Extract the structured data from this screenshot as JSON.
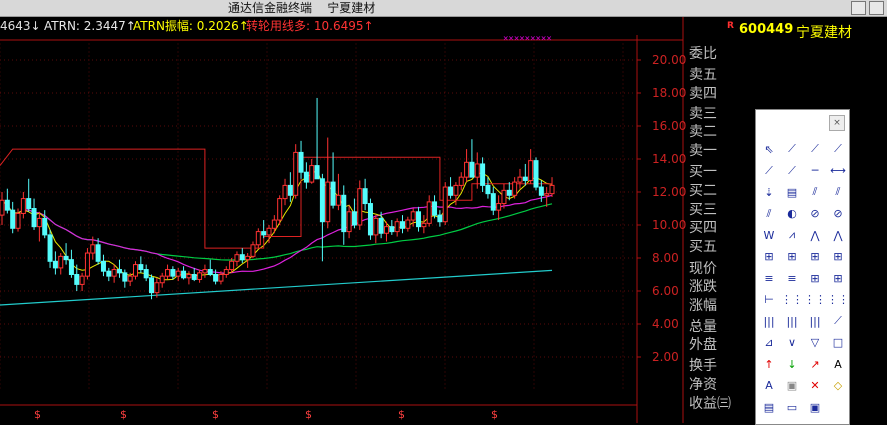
{
  "window": {
    "title": "通达信金融终端    宁夏建材"
  },
  "indicators": [
    {
      "text": "4643↓",
      "color": "#e0e0e0"
    },
    {
      "text": "ATRN: 2.3447↑",
      "color": "#e8e8e8"
    },
    {
      "text": "ATRN振幅: 0.2026↑",
      "color": "#ffff00"
    },
    {
      "text": "转轮用线多: 10.6495↑",
      "color": "#ff3333"
    }
  ],
  "stock": {
    "marker": "R",
    "code": "600449",
    "name": "宁夏建材"
  },
  "y_axis": {
    "ticks": [
      "20.00",
      "18.00",
      "16.00",
      "14.00",
      "12.00",
      "10.00",
      "8.00",
      "6.00",
      "4.00",
      "2.00"
    ]
  },
  "quote_labels": [
    "委比",
    "卖五",
    "卖四",
    "卖三",
    "卖二",
    "卖一",
    "买一",
    "买二",
    "买三",
    "买四",
    "买五",
    "现价",
    "涨跌",
    "涨幅",
    "总量",
    "外盘",
    "换手",
    "净资",
    "收益㈢"
  ],
  "signal_marker": "$",
  "chart_data": {
    "type": "candlestick",
    "title": "",
    "ylim": [
      0,
      21
    ],
    "ohlc": [
      [
        10.6,
        12.0,
        10.0,
        11.5
      ],
      [
        11.5,
        12.2,
        10.7,
        10.9
      ],
      [
        10.9,
        11.4,
        9.5,
        9.8
      ],
      [
        9.8,
        11.0,
        9.6,
        10.7
      ],
      [
        10.7,
        12.0,
        10.4,
        11.6
      ],
      [
        11.6,
        12.8,
        10.8,
        11.0
      ],
      [
        11.0,
        11.6,
        9.7,
        9.9
      ],
      [
        9.9,
        10.8,
        9.0,
        10.4
      ],
      [
        10.4,
        10.9,
        9.2,
        9.4
      ],
      [
        9.4,
        9.7,
        7.4,
        7.8
      ],
      [
        7.8,
        8.4,
        7.0,
        7.4
      ],
      [
        7.4,
        8.3,
        7.0,
        8.1
      ],
      [
        8.1,
        8.9,
        7.6,
        7.9
      ],
      [
        7.9,
        8.5,
        6.8,
        7.0
      ],
      [
        7.0,
        7.6,
        6.0,
        6.4
      ],
      [
        6.4,
        7.1,
        6.0,
        6.9
      ],
      [
        6.9,
        8.6,
        6.7,
        8.3
      ],
      [
        8.3,
        9.3,
        7.9,
        8.8
      ],
      [
        8.8,
        9.2,
        7.6,
        7.8
      ],
      [
        7.8,
        8.2,
        6.9,
        7.2
      ],
      [
        7.2,
        7.4,
        6.6,
        6.9
      ],
      [
        6.9,
        7.6,
        6.5,
        7.3
      ],
      [
        7.3,
        7.9,
        6.8,
        7.1
      ],
      [
        7.1,
        7.3,
        6.2,
        6.6
      ],
      [
        6.6,
        7.1,
        6.3,
        6.9
      ],
      [
        6.9,
        7.8,
        6.7,
        7.6
      ],
      [
        7.6,
        8.1,
        7.1,
        7.3
      ],
      [
        7.3,
        7.6,
        6.6,
        6.8
      ],
      [
        6.8,
        7.0,
        5.5,
        5.9
      ],
      [
        5.9,
        6.8,
        5.6,
        6.5
      ],
      [
        6.5,
        7.1,
        6.2,
        6.9
      ],
      [
        6.9,
        7.6,
        6.7,
        7.3
      ],
      [
        7.3,
        7.5,
        6.7,
        6.9
      ],
      [
        6.9,
        7.4,
        6.6,
        7.2
      ],
      [
        7.2,
        7.5,
        6.7,
        6.8
      ],
      [
        6.8,
        7.2,
        6.4,
        7.0
      ],
      [
        7.0,
        7.4,
        6.6,
        6.7
      ],
      [
        6.7,
        7.3,
        6.5,
        7.1
      ],
      [
        7.1,
        7.6,
        6.8,
        7.3
      ],
      [
        7.3,
        7.9,
        6.9,
        7.0
      ],
      [
        7.0,
        7.3,
        6.4,
        6.6
      ],
      [
        6.6,
        7.2,
        6.4,
        7.0
      ],
      [
        7.0,
        7.5,
        6.8,
        7.3
      ],
      [
        7.3,
        8.0,
        7.1,
        7.8
      ],
      [
        7.8,
        8.4,
        7.5,
        8.2
      ],
      [
        8.2,
        8.6,
        7.7,
        7.9
      ],
      [
        7.9,
        8.3,
        7.4,
        8.1
      ],
      [
        8.1,
        9.0,
        8.0,
        8.8
      ],
      [
        8.8,
        9.8,
        8.6,
        9.6
      ],
      [
        9.6,
        10.3,
        9.2,
        9.4
      ],
      [
        9.4,
        10.0,
        8.9,
        9.8
      ],
      [
        9.8,
        10.6,
        9.5,
        10.3
      ],
      [
        10.3,
        11.8,
        10.0,
        11.6
      ],
      [
        11.6,
        12.8,
        11.2,
        12.4
      ],
      [
        12.4,
        13.2,
        11.4,
        11.8
      ],
      [
        11.8,
        14.9,
        11.6,
        14.4
      ],
      [
        14.4,
        15.1,
        12.8,
        13.2
      ],
      [
        13.2,
        13.8,
        12.2,
        12.6
      ],
      [
        12.6,
        14.0,
        12.5,
        13.6
      ],
      [
        13.6,
        17.7,
        13.2,
        12.8
      ],
      [
        12.8,
        13.1,
        7.8,
        10.2
      ],
      [
        10.2,
        15.3,
        9.8,
        12.6
      ],
      [
        12.6,
        14.4,
        11.0,
        11.2
      ],
      [
        11.2,
        13.1,
        10.9,
        11.8
      ],
      [
        11.8,
        12.4,
        8.8,
        9.6
      ],
      [
        9.6,
        11.2,
        9.2,
        10.8
      ],
      [
        10.8,
        11.6,
        9.8,
        10.0
      ],
      [
        10.0,
        12.7,
        9.7,
        12.2
      ],
      [
        12.2,
        12.8,
        10.9,
        11.3
      ],
      [
        11.3,
        11.6,
        9.1,
        9.4
      ],
      [
        9.4,
        10.6,
        8.9,
        10.4
      ],
      [
        10.4,
        10.8,
        9.2,
        9.5
      ],
      [
        9.5,
        10.2,
        9.0,
        9.9
      ],
      [
        9.9,
        10.3,
        9.4,
        9.6
      ],
      [
        9.6,
        10.4,
        9.3,
        10.2
      ],
      [
        10.2,
        10.6,
        9.5,
        9.8
      ],
      [
        9.8,
        10.5,
        9.6,
        10.3
      ],
      [
        10.3,
        11.0,
        9.9,
        10.8
      ],
      [
        10.8,
        11.1,
        9.6,
        9.9
      ],
      [
        9.9,
        10.6,
        9.5,
        10.1
      ],
      [
        10.1,
        11.8,
        9.9,
        11.4
      ],
      [
        11.4,
        11.8,
        10.4,
        10.6
      ],
      [
        10.6,
        10.9,
        9.9,
        10.2
      ],
      [
        10.2,
        12.6,
        10.0,
        12.3
      ],
      [
        12.3,
        12.9,
        11.6,
        11.8
      ],
      [
        11.8,
        12.6,
        11.2,
        12.4
      ],
      [
        12.4,
        13.2,
        12.1,
        12.9
      ],
      [
        12.9,
        14.6,
        12.6,
        13.8
      ],
      [
        13.8,
        15.2,
        13.3,
        12.9
      ],
      [
        12.9,
        14.4,
        12.2,
        13.7
      ],
      [
        13.7,
        14.1,
        12.0,
        12.4
      ],
      [
        12.4,
        12.9,
        11.6,
        11.9
      ],
      [
        11.9,
        12.3,
        10.6,
        10.9
      ],
      [
        10.9,
        11.8,
        10.3,
        11.3
      ],
      [
        11.3,
        12.5,
        11.0,
        12.1
      ],
      [
        12.1,
        12.6,
        11.5,
        11.8
      ],
      [
        11.8,
        12.9,
        11.6,
        12.6
      ],
      [
        12.6,
        13.4,
        12.2,
        12.9
      ],
      [
        12.9,
        13.7,
        12.4,
        12.7
      ],
      [
        12.7,
        14.6,
        12.5,
        13.9
      ],
      [
        13.9,
        14.1,
        12.1,
        12.3
      ],
      [
        12.3,
        12.7,
        11.4,
        11.8
      ],
      [
        11.8,
        12.3,
        11.1,
        11.9
      ],
      [
        11.9,
        12.9,
        11.7,
        12.4
      ]
    ]
  }
}
